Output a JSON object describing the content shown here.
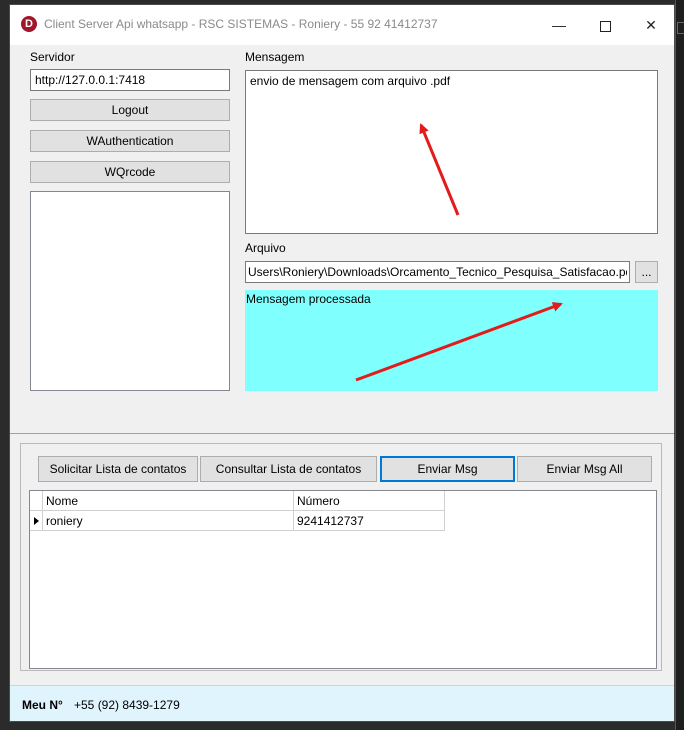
{
  "window": {
    "title": "Client Server Api whatsapp - RSC SISTEMAS - Roniery - 55 92 41412737",
    "icon_letter": "D",
    "min_glyph": "—",
    "close_glyph": "✕"
  },
  "left": {
    "server_label": "Servidor",
    "server_value": "http://127.0.0.1:7418",
    "logout": "Logout",
    "wauth": "WAuthentication",
    "wqrcode": "WQrcode"
  },
  "message": {
    "label": "Mensagem",
    "value": "envio de mensagem com arquivo .pdf"
  },
  "file": {
    "label": "Arquivo",
    "value": "Users\\Roniery\\Downloads\\Orcamento_Tecnico_Pesquisa_Satisfacao.pdf",
    "browse": "..."
  },
  "result": {
    "text": "Mensagem processada"
  },
  "actions": {
    "request_contacts": "Solicitar Lista de contatos",
    "consult_contacts": "Consultar Lista de contatos",
    "send_msg": "Enviar Msg",
    "send_msg_all": "Enviar Msg All"
  },
  "grid": {
    "columns": [
      "Nome",
      "Número"
    ],
    "rows": [
      [
        "roniery",
        "9241412737"
      ]
    ]
  },
  "status": {
    "label": "Meu N°",
    "value": "+55 (92) 8439-1279"
  },
  "colors": {
    "accent": "#0078d7",
    "result_bg": "#80ffff",
    "arrow": "#e31b1b",
    "status_bg": "#dff4fd"
  }
}
